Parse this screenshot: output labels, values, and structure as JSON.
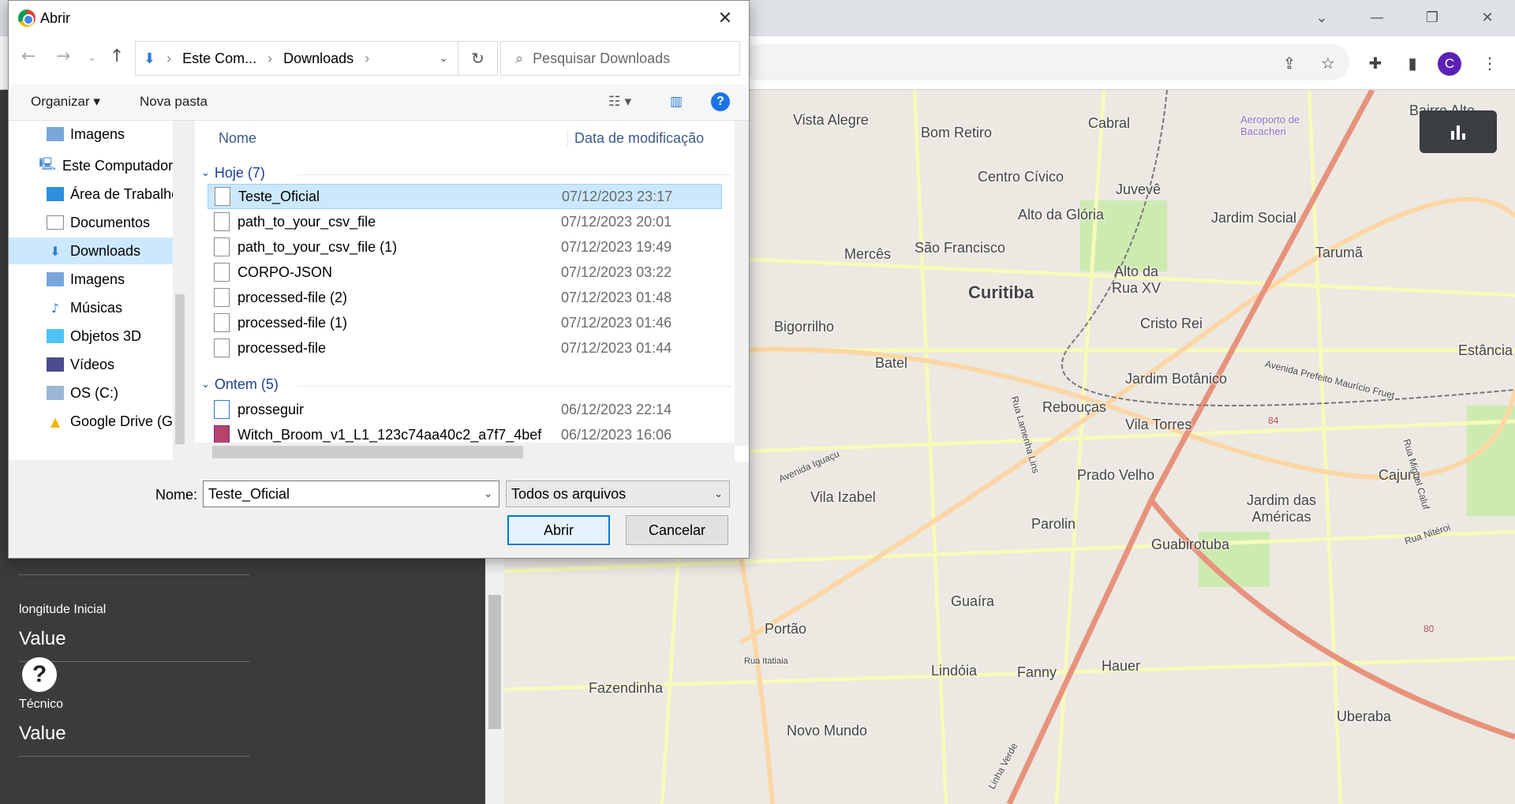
{
  "browser": {
    "profile_initial": "C"
  },
  "form": {
    "fields": [
      {
        "label": "",
        "value": "Value"
      },
      {
        "label": "longitude Inicial",
        "value": "Value"
      },
      {
        "label": "Técnico",
        "value": "Value"
      }
    ],
    "help_label": "?"
  },
  "map": {
    "labels": [
      "Vista Alegre",
      "Bom Retiro",
      "Cabral",
      "Aeroporto de Bacacheri",
      "Bairro Alto",
      "Centro Cívico",
      "Juvevê",
      "Alto da Glória",
      "Jardim Social",
      "Mercês",
      "São Francisco",
      "Tarumã",
      "Curitiba",
      "Alto da Rua XV",
      "Cristo Rei",
      "Bigorrilho",
      "Batel",
      "Jardim Botânico",
      "Estância P",
      "Rebouças",
      "Vila Torres",
      "Avenida Prefeito Maurício Fruet",
      "Avenida Iguaçu",
      "Rua Lamenha Lins",
      "Prado Velho",
      "Cajuru",
      "Vila Izabel",
      "Jardim das Américas",
      "Parolin",
      "Guabirotuba",
      "Guaíra",
      "Portão",
      "Rua Itatiaia",
      "Lindóia",
      "Fanny",
      "Hauer",
      "Fazendinha",
      "Novo Mundo",
      "Uberaba",
      "Rua Nitéroi",
      "Rua Miguel Caluf",
      "Linha Verde",
      "84",
      "80"
    ]
  },
  "dialog": {
    "title": "Abrir",
    "breadcrumb": [
      "Este Com...",
      "Downloads"
    ],
    "search_placeholder": "Pesquisar Downloads",
    "organize": "Organizar",
    "new_folder": "Nova pasta",
    "nav_items": [
      "Imagens",
      "Este Computador",
      "Área de Trabalho",
      "Documentos",
      "Downloads",
      "Imagens",
      "Músicas",
      "Objetos 3D",
      "Vídeos",
      "OS (C:)",
      "Google Drive (G:"
    ],
    "columns": {
      "name": "Nome",
      "date": "Data de modificação"
    },
    "groups": [
      {
        "label": "Hoje (7)",
        "files": [
          {
            "name": "Teste_Oficial",
            "date": "07/12/2023 23:17"
          },
          {
            "name": "path_to_your_csv_file",
            "date": "07/12/2023 20:01"
          },
          {
            "name": "path_to_your_csv_file (1)",
            "date": "07/12/2023 19:49"
          },
          {
            "name": "CORPO-JSON",
            "date": "07/12/2023 03:22"
          },
          {
            "name": "processed-file (2)",
            "date": "07/12/2023 01:48"
          },
          {
            "name": "processed-file (1)",
            "date": "07/12/2023 01:46"
          },
          {
            "name": "processed-file",
            "date": "07/12/2023 01:44"
          }
        ]
      },
      {
        "label": "Ontem (5)",
        "files": [
          {
            "name": "prosseguir",
            "date": "06/12/2023 22:14"
          },
          {
            "name": "Witch_Broom_v1_L1_123c74aa40c2_a7f7_4bef",
            "date": "06/12/2023 16:06"
          }
        ]
      }
    ],
    "name_label": "Nome:",
    "name_value": "Teste_Oficial",
    "file_type": "Todos os arquivos",
    "open": "Abrir",
    "cancel": "Cancelar"
  }
}
